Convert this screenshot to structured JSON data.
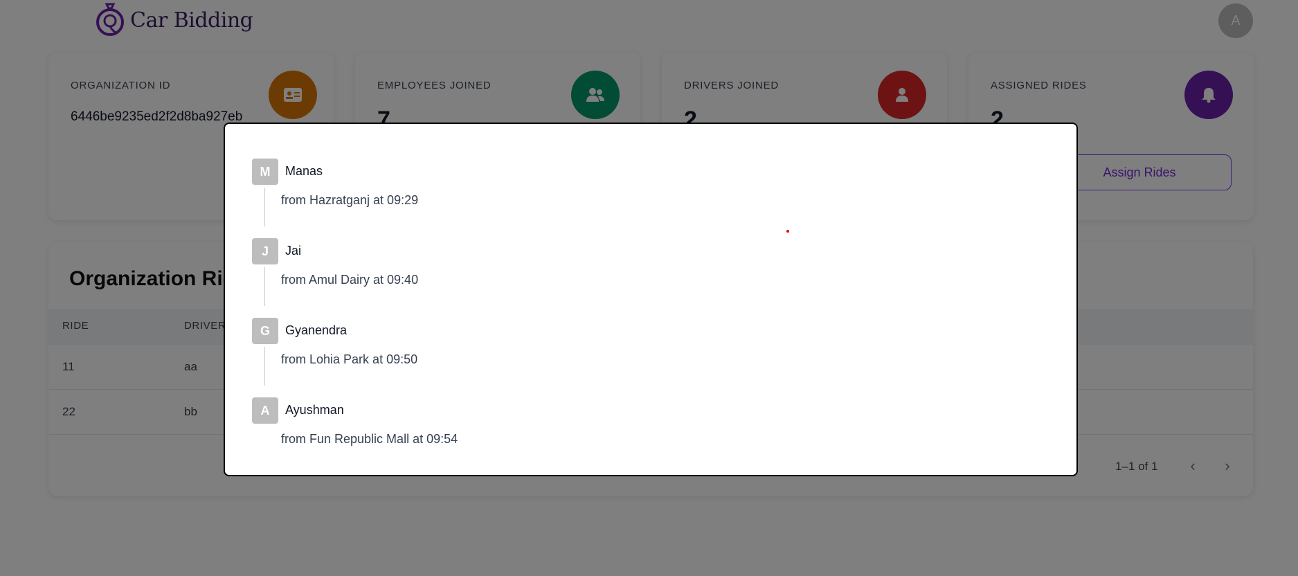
{
  "header": {
    "app_name": "Car Bidding",
    "user_avatar_letter": "A"
  },
  "stats": [
    {
      "label": "ORGANIZATION ID",
      "value": "6446be9235ed2f2d8ba927eb",
      "icon": "id-card-icon",
      "color": "#d97706"
    },
    {
      "label": "EMPLOYEES JOINED",
      "value": "7",
      "icon": "users-icon",
      "color": "#059669"
    },
    {
      "label": "DRIVERS JOINED",
      "value": "2",
      "icon": "user-icon",
      "color": "#dc2626"
    },
    {
      "label": "ASSIGNED RIDES",
      "value": "2",
      "icon": "bell-icon",
      "color": "#6b21a8"
    }
  ],
  "assign_button_label": "Assign Rides",
  "rides_table": {
    "title": "Organization Rides",
    "columns": [
      "RIDE",
      "DRIVER"
    ],
    "rows": [
      [
        "11",
        "aa"
      ],
      [
        "22",
        "bb"
      ]
    ],
    "pagination": "1–1 of 1"
  },
  "modal": {
    "timeline": [
      {
        "initial": "M",
        "name": "Manas",
        "detail": "from Hazratganj at 09:29"
      },
      {
        "initial": "J",
        "name": "Jai",
        "detail": "from Amul Dairy at 09:40"
      },
      {
        "initial": "G",
        "name": "Gyanendra",
        "detail": "from Lohia Park at 09:50"
      },
      {
        "initial": "A",
        "name": "Ayushman",
        "detail": "from Fun Republic Mall at 09:54"
      }
    ]
  }
}
